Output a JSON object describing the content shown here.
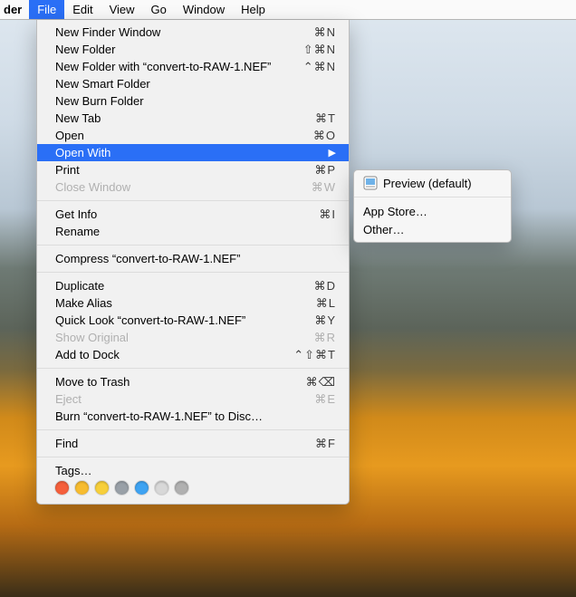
{
  "menubar": {
    "appname": "der",
    "items": [
      "File",
      "Edit",
      "View",
      "Go",
      "Window",
      "Help"
    ],
    "active_index": 0
  },
  "file_menu": {
    "groups": [
      [
        {
          "label": "New Finder Window",
          "shortcut": "⌘N",
          "enabled": true
        },
        {
          "label": "New Folder",
          "shortcut": "⇧⌘N",
          "enabled": true
        },
        {
          "label": "New Folder with “convert-to-RAW-1.NEF”",
          "shortcut": "⌃⌘N",
          "enabled": true
        },
        {
          "label": "New Smart Folder",
          "shortcut": "",
          "enabled": true
        },
        {
          "label": "New Burn Folder",
          "shortcut": "",
          "enabled": true
        },
        {
          "label": "New Tab",
          "shortcut": "⌘T",
          "enabled": true
        },
        {
          "label": "Open",
          "shortcut": "⌘O",
          "enabled": true
        },
        {
          "label": "Open With",
          "shortcut": "",
          "enabled": true,
          "highlight": true,
          "submenu": true
        },
        {
          "label": "Print",
          "shortcut": "⌘P",
          "enabled": true
        },
        {
          "label": "Close Window",
          "shortcut": "⌘W",
          "enabled": false
        }
      ],
      [
        {
          "label": "Get Info",
          "shortcut": "⌘I",
          "enabled": true
        },
        {
          "label": "Rename",
          "shortcut": "",
          "enabled": true
        }
      ],
      [
        {
          "label": "Compress “convert-to-RAW-1.NEF”",
          "shortcut": "",
          "enabled": true
        }
      ],
      [
        {
          "label": "Duplicate",
          "shortcut": "⌘D",
          "enabled": true
        },
        {
          "label": "Make Alias",
          "shortcut": "⌘L",
          "enabled": true
        },
        {
          "label": "Quick Look “convert-to-RAW-1.NEF”",
          "shortcut": "⌘Y",
          "enabled": true
        },
        {
          "label": "Show Original",
          "shortcut": "⌘R",
          "enabled": false
        },
        {
          "label": "Add to Dock",
          "shortcut": "⌃⇧⌘T",
          "enabled": true
        }
      ],
      [
        {
          "label": "Move to Trash",
          "shortcut": "⌘⌫",
          "enabled": true
        },
        {
          "label": "Eject",
          "shortcut": "⌘E",
          "enabled": false
        },
        {
          "label": "Burn “convert-to-RAW-1.NEF” to Disc…",
          "shortcut": "",
          "enabled": true
        }
      ],
      [
        {
          "label": "Find",
          "shortcut": "⌘F",
          "enabled": true
        }
      ],
      [
        {
          "label": "Tags…",
          "shortcut": "",
          "enabled": true
        }
      ]
    ],
    "tag_colors": [
      "#f55f3b",
      "#f7bc2f",
      "#f7cf3a",
      "#99a0a7",
      "#3ea3f2",
      "#d8d8d8",
      "#b0b0b0"
    ]
  },
  "open_with_submenu": {
    "items": [
      {
        "label": "Preview (default)",
        "icon": "preview-app-icon"
      },
      {
        "separator": true
      },
      {
        "label": "App Store…"
      },
      {
        "label": "Other…"
      }
    ]
  }
}
